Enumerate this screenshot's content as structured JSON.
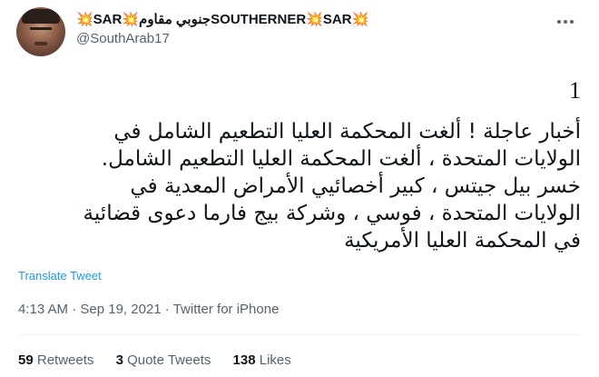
{
  "header": {
    "display_name": "💥SAR💥جنوبي مقاومSOUTHERNER💥SAR💥",
    "handle": "@SouthArab17"
  },
  "tweet": {
    "lines": [
      "1",
      "أخبار عاجلة ! ألغت المحكمة العليا التطعيم الشامل في",
      "الولايات المتحدة ، ألغت المحكمة العليا التطعيم الشامل.",
      "خسر بيل جيتس ، كبير أخصائيي الأمراض المعدية في",
      "الولايات المتحدة ، فوسي ، وشركة بيج فارما دعوى قضائية",
      "في المحكمة العليا الأمريكية"
    ],
    "translate_label": "Translate Tweet"
  },
  "meta": {
    "time": "4:13 AM",
    "separator1": " · ",
    "date": "Sep 19, 2021",
    "separator2": " · ",
    "source": "Twitter for iPhone"
  },
  "stats": {
    "retweets_count": "59",
    "retweets_label": "Retweets",
    "quotes_count": "3",
    "quotes_label": "Quote Tweets",
    "likes_count": "138",
    "likes_label": "Likes"
  }
}
